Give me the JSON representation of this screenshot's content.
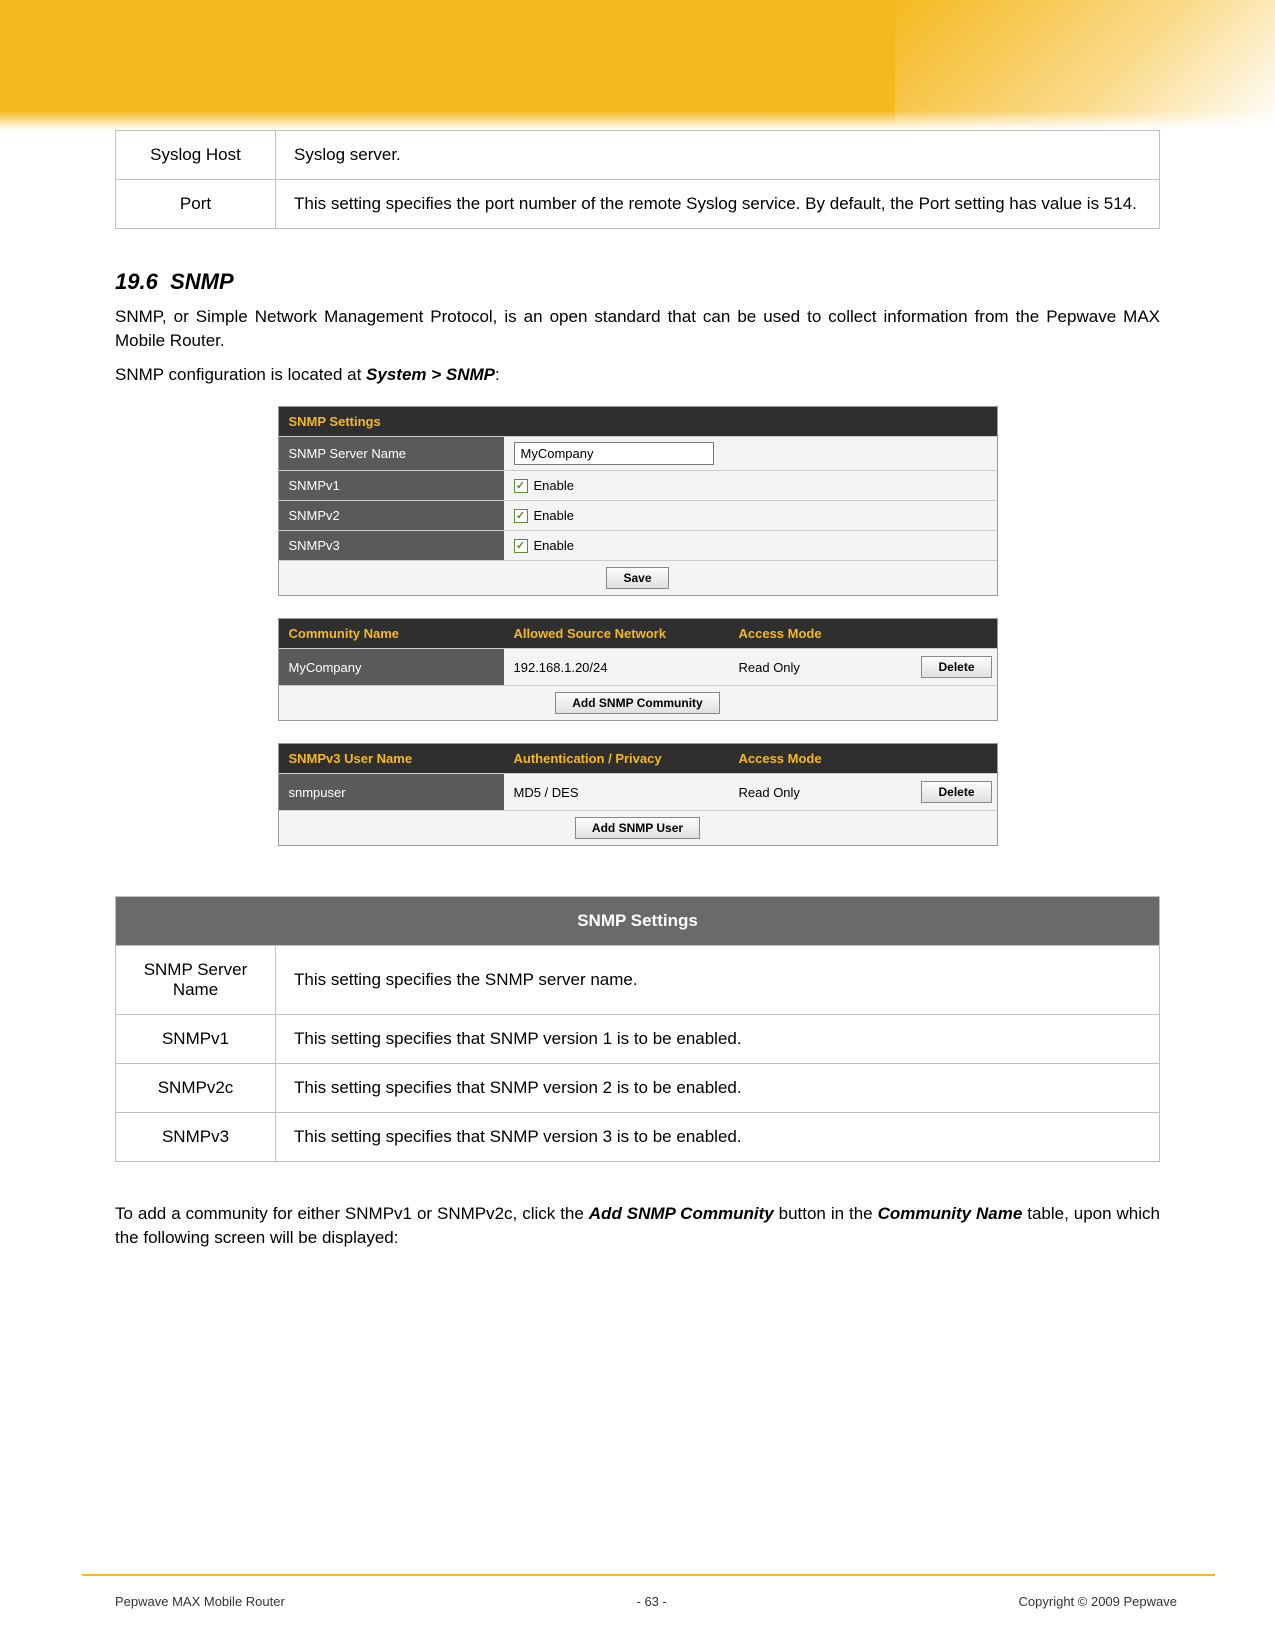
{
  "syslog_table": {
    "rows": [
      {
        "label": "Syslog Host",
        "value": "Syslog server."
      },
      {
        "label": "Port",
        "value": "This setting specifies the port number of the remote Syslog service. By default, the Port setting has value is 514."
      }
    ]
  },
  "section": {
    "number": "19.6",
    "title": "SNMP",
    "para1": "SNMP, or Simple Network Management Protocol, is an open standard that can be used to collect information from the Pepwave MAX Mobile Router.",
    "para2_pre": "SNMP configuration is located at ",
    "para2_bold": "System > SNMP",
    "para2_post": ":"
  },
  "snmp_panel": {
    "header": "SNMP Settings",
    "server_name_label": "SNMP Server Name",
    "server_name_value": "MyCompany",
    "v1_label": "SNMPv1",
    "v2_label": "SNMPv2",
    "v3_label": "SNMPv3",
    "enable_text": "Enable",
    "save_btn": "Save"
  },
  "community_grid": {
    "head_a": "Community Name",
    "head_b": "Allowed Source Network",
    "head_c": "Access Mode",
    "row": {
      "name": "MyCompany",
      "network": "192.168.1.20/24",
      "mode": "Read Only",
      "delete": "Delete"
    },
    "add_btn": "Add SNMP Community"
  },
  "user_grid": {
    "head_a": "SNMPv3 User Name",
    "head_b": "Authentication / Privacy",
    "head_c": "Access Mode",
    "row": {
      "name": "snmpuser",
      "auth": "MD5 / DES",
      "mode": "Read Only",
      "delete": "Delete"
    },
    "add_btn": "Add SNMP User"
  },
  "snmp_settings_table": {
    "header": "SNMP Settings",
    "rows": [
      {
        "label": "SNMP Server Name",
        "value": "This setting specifies the SNMP server name."
      },
      {
        "label": "SNMPv1",
        "value": "This setting specifies that SNMP version 1 is to be enabled."
      },
      {
        "label": "SNMPv2c",
        "value": "This setting specifies that SNMP version 2 is to be enabled."
      },
      {
        "label": "SNMPv3",
        "value": "This setting specifies that SNMP version 3 is to be enabled."
      }
    ]
  },
  "closing_para": {
    "pre": "To add a community for either SNMPv1 or SNMPv2c, click the ",
    "b1": "Add SNMP Community",
    "mid": " button in the ",
    "b2": "Community Name",
    "post": " table, upon which the following screen will be displayed:"
  },
  "footer": {
    "left": "Pepwave MAX Mobile Router",
    "center": "- 63 -",
    "right": "Copyright © 2009 Pepwave"
  }
}
